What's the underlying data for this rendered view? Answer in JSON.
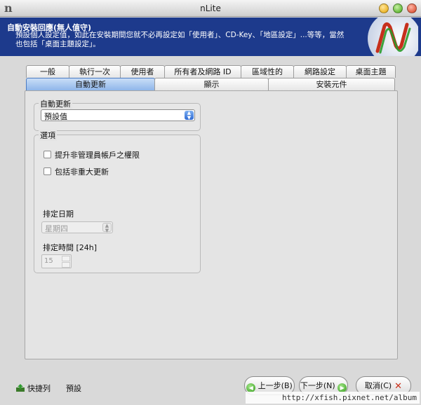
{
  "window": {
    "title": "nLite"
  },
  "banner": {
    "title": "自動安裝回應(無人值守)",
    "description": "預設個人設定值，如此在安裝期間您就不必再設定如「使用者」、CD-Key、「地區設定」...等等，當然也包括「桌面主題設定」。"
  },
  "tabs": {
    "row1": [
      "一般",
      "執行一次",
      "使用者",
      "所有者及網路 ID",
      "區域性的",
      "網路設定",
      "桌面主題"
    ],
    "row2": [
      "自動更新",
      "顯示",
      "安裝元件"
    ],
    "active": "自動更新"
  },
  "auto_update_group": {
    "legend": "自動更新",
    "selected": "預設值"
  },
  "options_group": {
    "legend": "選項",
    "checkbox1": "提升非管理員帳戶之權限",
    "checkbox2": "包括非重大更新",
    "schedule_day_label": "排定日期",
    "schedule_day_value": "星期四",
    "schedule_time_label": "排定時間 [24h]",
    "schedule_time_value": "15"
  },
  "footer": {
    "shortcut_label": "快捷列",
    "preset_label": "預設",
    "back_label": "上一步(B)",
    "next_label": "下一步(N)",
    "cancel_label": "取消(C)"
  },
  "watermark": "http://xfish.pixnet.net/album",
  "colors": {
    "banner": "#1d3a8c",
    "active_tab": "#8fb6ea"
  },
  "icons": {
    "app": "nlite-logo-icon",
    "next": "arrow-right-icon",
    "back": "arrow-left-icon",
    "cancel": "x-icon"
  }
}
